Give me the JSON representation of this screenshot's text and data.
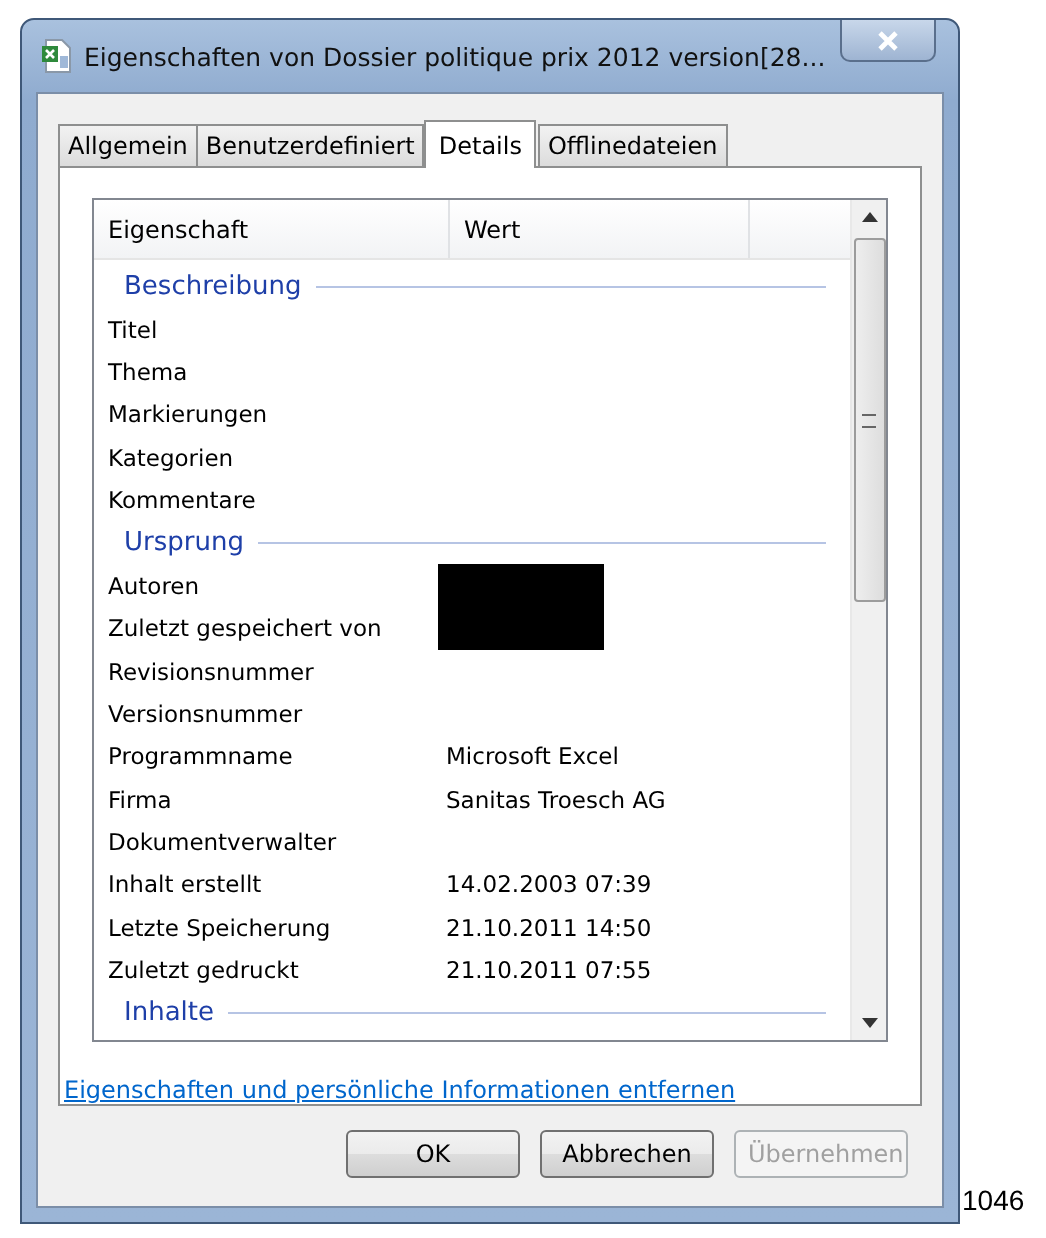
{
  "window": {
    "title": "Eigenschaften von Dossier politique prix 2012 version[28..."
  },
  "tabs": [
    {
      "label": "Allgemein",
      "selected": false
    },
    {
      "label": "Benutzerdefiniert",
      "selected": false
    },
    {
      "label": "Details",
      "selected": true
    },
    {
      "label": "Offlinedateien",
      "selected": false
    }
  ],
  "table": {
    "columns": [
      "Eigenschaft",
      "Wert"
    ],
    "rows": [
      {
        "kind": "group",
        "label": "Beschreibung"
      },
      {
        "kind": "property",
        "name": "Titel"
      },
      {
        "kind": "property",
        "name": "Thema"
      },
      {
        "kind": "property",
        "name": "Markierungen"
      },
      {
        "kind": "property",
        "name": "Kategorien"
      },
      {
        "kind": "property",
        "name": "Kommentare"
      },
      {
        "kind": "group",
        "label": "Ursprung"
      },
      {
        "kind": "property",
        "name": "Autoren",
        "redacted": true
      },
      {
        "kind": "property",
        "name": "Zuletzt gespeichert von",
        "redacted": true
      },
      {
        "kind": "property",
        "name": "Revisionsnummer"
      },
      {
        "kind": "property",
        "name": "Versionsnummer"
      },
      {
        "kind": "property",
        "name": "Programmname",
        "value": "Microsoft Excel"
      },
      {
        "kind": "property",
        "name": "Firma",
        "value": "Sanitas Troesch AG"
      },
      {
        "kind": "property",
        "name": "Dokumentverwalter"
      },
      {
        "kind": "property",
        "name": "Inhalt erstellt",
        "value": "14.02.2003 07:39"
      },
      {
        "kind": "property",
        "name": "Letzte Speicherung",
        "value": "21.10.2011 14:50"
      },
      {
        "kind": "property",
        "name": "Zuletzt gedruckt",
        "value": "21.10.2011 07:55"
      },
      {
        "kind": "group",
        "label": "Inhalte"
      }
    ]
  },
  "link": "Eigenschaften und persönliche Informationen entfernen",
  "buttons": [
    {
      "label": "OK",
      "disabled": false
    },
    {
      "label": "Abbrechen",
      "disabled": false
    },
    {
      "label": "Übernehmen",
      "disabled": true
    }
  ],
  "page_number": "1046"
}
